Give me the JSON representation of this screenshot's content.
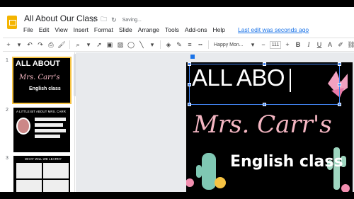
{
  "app": {
    "title": "All About Our Class",
    "saving": "Saving...",
    "last_edit": "Last edit was seconds ago"
  },
  "menu": [
    "File",
    "Edit",
    "View",
    "Insert",
    "Format",
    "Slide",
    "Arrange",
    "Tools",
    "Add-ons",
    "Help"
  ],
  "toolbar": {
    "font": "Happy Mon...",
    "font_size": "111",
    "bold": "B",
    "italic": "I",
    "underline": "U",
    "text_color": "A"
  },
  "filmstrip": {
    "slide_numbers": [
      "1",
      "2",
      "3"
    ],
    "slide1": {
      "title": "ALL ABOUT",
      "name": "Mrs. Carr's",
      "subtitle": "English class"
    },
    "slide2": {
      "title": "A LITTLE BIT ABOUT MRS. CARR"
    },
    "slide3": {
      "title": "WHAT WILL WE LEARN?"
    }
  },
  "slide": {
    "title_text": "ALL ABO",
    "name": "Mrs. Carr's",
    "subtitle": "English class"
  },
  "colors": {
    "accent": "#4285f4",
    "logo": "#f4b400",
    "pink": "#f4b6c2"
  }
}
